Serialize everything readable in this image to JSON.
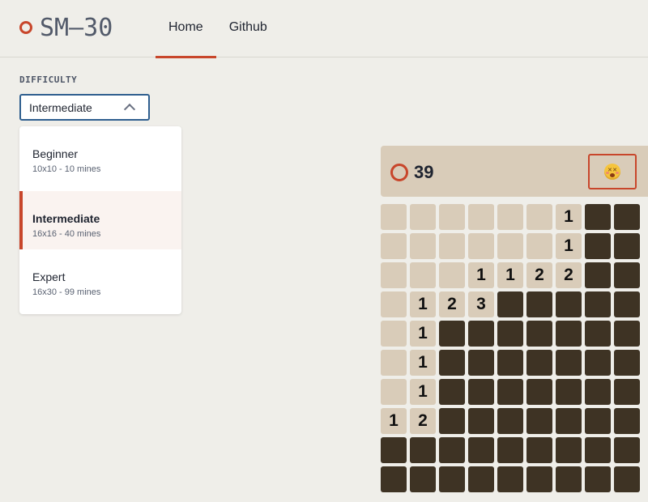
{
  "header": {
    "logo_text": "SM—30",
    "nav": [
      {
        "label": "Home",
        "active": true
      },
      {
        "label": "Github",
        "active": false
      }
    ]
  },
  "difficulty": {
    "label": "DIFFICULTY",
    "selected": "Intermediate",
    "expanded": true,
    "options": [
      {
        "name": "Beginner",
        "desc": "10x10 - 10 mines"
      },
      {
        "name": "Intermediate",
        "desc": "16x16 - 40 mines"
      },
      {
        "name": "Expert",
        "desc": "16x30 - 99 mines"
      }
    ]
  },
  "game": {
    "mines_remaining": "39",
    "status_face": "dizzy-face",
    "board_visible": [
      [
        "",
        "",
        "",
        "",
        "",
        "",
        "1",
        "#",
        "#"
      ],
      [
        "",
        "",
        "",
        "",
        "",
        "",
        "1",
        "#",
        "#"
      ],
      [
        "",
        "",
        "",
        "1",
        "1",
        "2",
        "2",
        "#",
        "#"
      ],
      [
        "",
        "1",
        "2",
        "3",
        "#",
        "#",
        "#",
        "#",
        "#"
      ],
      [
        "",
        "1",
        "#",
        "#",
        "#",
        "#",
        "#",
        "#",
        "#"
      ],
      [
        "",
        "1",
        "#",
        "#",
        "#",
        "#",
        "#",
        "#",
        "#"
      ],
      [
        "",
        "1",
        "#",
        "#",
        "#",
        "#",
        "#",
        "#",
        "#"
      ],
      [
        "1",
        "2",
        "#",
        "#",
        "#",
        "#",
        "#",
        "#",
        "#"
      ],
      [
        "#",
        "#",
        "#",
        "#",
        "#",
        "#",
        "#",
        "#",
        "#"
      ],
      [
        "#",
        "#",
        "#",
        "#",
        "#",
        "#",
        "#",
        "#",
        "#"
      ]
    ]
  },
  "colors": {
    "accent": "#c8462b",
    "focus_border": "#2f5f8f",
    "background": "#efeee9",
    "cell_open": "#d9ccb9",
    "cell_hidden": "#3e3324"
  }
}
